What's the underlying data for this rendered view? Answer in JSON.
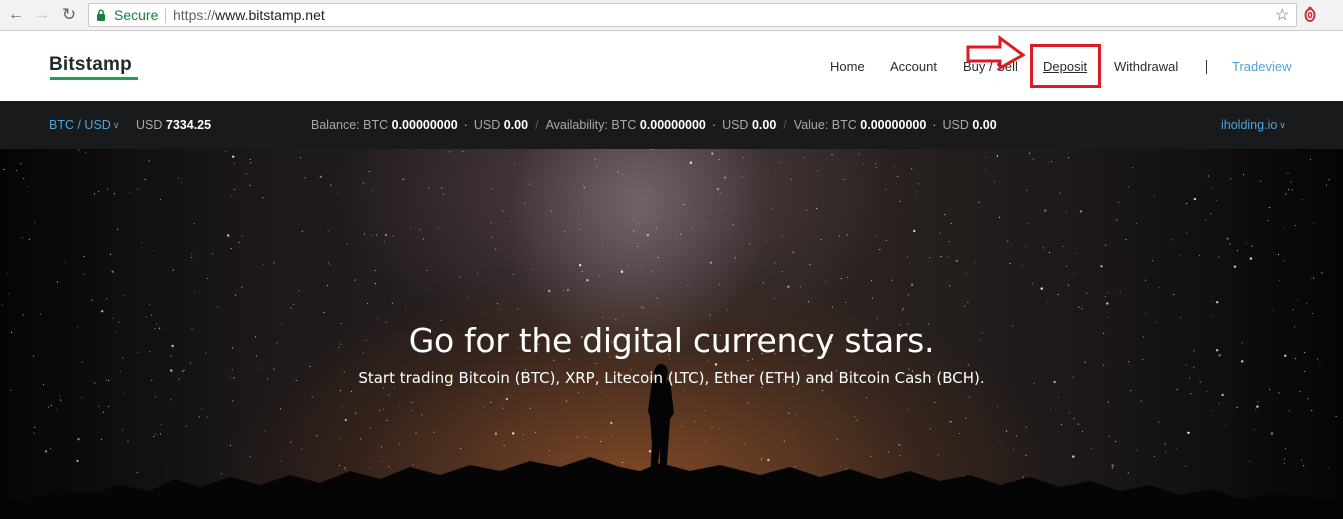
{
  "browser": {
    "secure_label": "Secure",
    "url_scheme": "https://",
    "url_host": "www.bitstamp.net",
    "icons": [
      "back-arrow-icon",
      "forward-arrow-icon",
      "reload-icon",
      "lock-icon",
      "star-icon",
      "extension-icon"
    ]
  },
  "header": {
    "logo": "Bitstamp",
    "nav": {
      "home": "Home",
      "account": "Account",
      "buy_sell": "Buy / Sell",
      "deposit": "Deposit",
      "withdrawal": "Withdrawal",
      "tradeview": "Tradeview"
    }
  },
  "ticker": {
    "pair": "BTC / USD",
    "price_currency": "USD",
    "price_value": "7334.25",
    "balance_label": "Balance:",
    "availability_label": "Availability:",
    "value_label": "Value:",
    "btc_label": "BTC",
    "usd_label": "USD",
    "balance_btc": "0.00000000",
    "balance_usd": "0.00",
    "availability_btc": "0.00000000",
    "availability_usd": "0.00",
    "value_btc": "0.00000000",
    "value_usd": "0.00",
    "account_name": "iholding.io"
  },
  "hero": {
    "title": "Go for the digital currency stars.",
    "subtitle": "Start trading Bitcoin (BTC), XRP, Litecoin (LTC), Ether (ETH) and Bitcoin Cash (BCH)."
  },
  "colors": {
    "link_blue": "#4ea5d9",
    "brand_green": "#1fa155",
    "annotation_red": "#e01a22",
    "ticker_bg": "#191a1c"
  }
}
